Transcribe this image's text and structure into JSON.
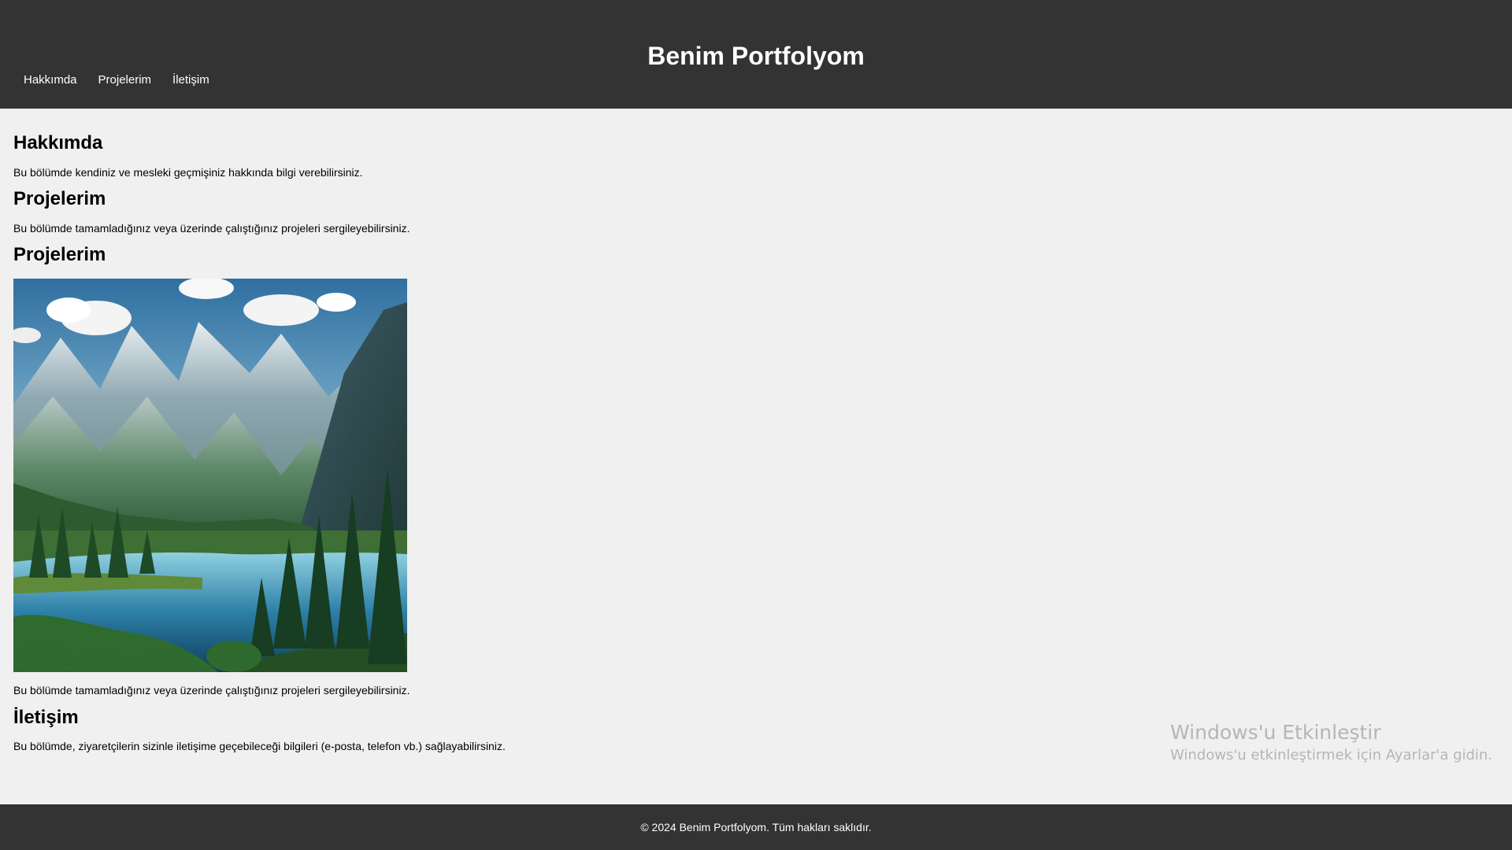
{
  "header": {
    "title": "Benim Portfolyom",
    "nav": [
      {
        "label": "Hakkımda"
      },
      {
        "label": "Projelerim"
      },
      {
        "label": "İletişim"
      }
    ]
  },
  "main": {
    "about": {
      "title": "Hakkımda",
      "text": "Bu bölümde kendiniz ve mesleki geçmişiniz hakkında bilgi verebilirsiniz."
    },
    "projects": {
      "title": "Projelerim",
      "text": "Bu bölümde tamamladığınız veya üzerinde çalıştığınız projeleri sergileyebilirsiniz."
    },
    "projects_gallery": {
      "title": "Projelerim",
      "image_icon": "mountain-lake-landscape",
      "text": "Bu bölümde tamamladığınız veya üzerinde çalıştığınız projeleri sergileyebilirsiniz."
    },
    "contact": {
      "title": "İletişim",
      "text": "Bu bölümde, ziyaretçilerin sizinle iletişime geçebileceği bilgileri (e-posta, telefon vb.) sağlayabilirsiniz."
    }
  },
  "watermark": {
    "title": "Windows'u Etkinleştir",
    "subtitle": "Windows'u etkinleştirmek için Ayarlar'a gidin."
  },
  "footer": {
    "text": "© 2024 Benim Portfolyom. Tüm hakları saklıdır."
  },
  "colors": {
    "header_bg": "#333333",
    "page_bg": "#f0f0f0",
    "header_text": "#ffffff"
  }
}
